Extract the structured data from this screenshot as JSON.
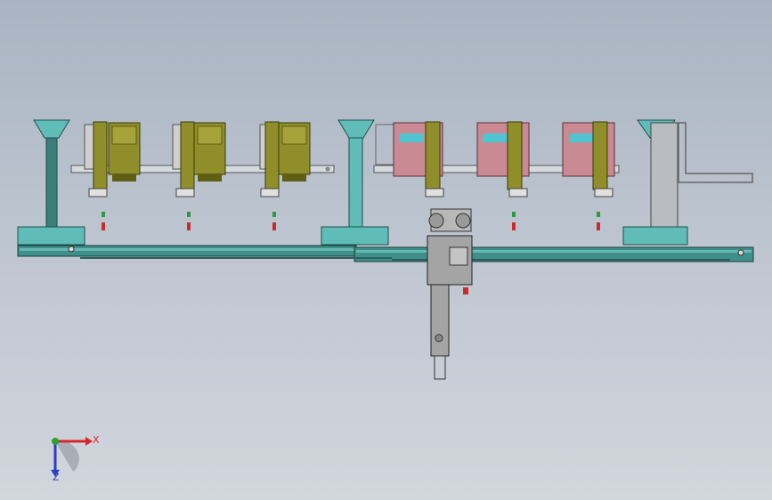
{
  "colors": {
    "frame": "#3f8f8a",
    "frame_light": "#66b8b2",
    "teal_base": "#5fbcb7",
    "olive": "#8f8e2a",
    "olive_dark": "#5f5e12",
    "panel": "#9aa09a",
    "pink": "#c98a93",
    "cyan": "#4fc3d0",
    "red_light": "#cc2b2b",
    "green_light": "#2e9b3a",
    "gray_unit": "#9a9a9a",
    "axis_x": "#d8262a",
    "axis_y": "#2da12d",
    "axis_z": "#2a3fc8"
  },
  "axes": {
    "x_label": "X",
    "z_label": "Z"
  },
  "icons": {
    "triad": "coordinate-triad-icon"
  }
}
